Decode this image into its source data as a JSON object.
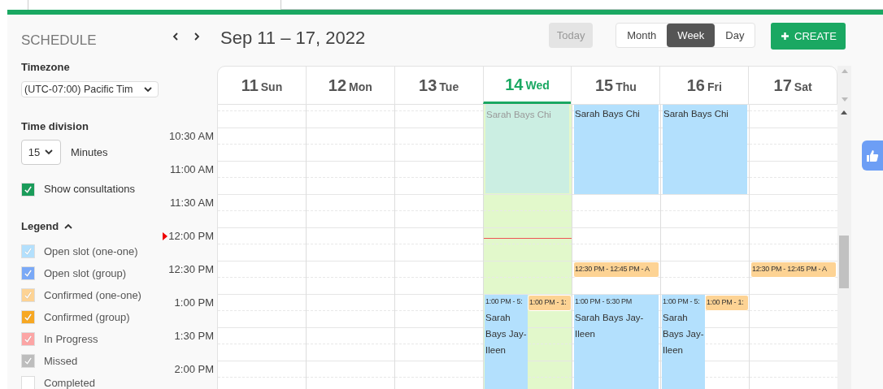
{
  "sidebar": {
    "title": "SCHEDULE",
    "timezone": {
      "label": "Timezone",
      "value": "(UTC-07:00) Pacific Tim"
    },
    "time_division": {
      "label": "Time division",
      "value": "15",
      "unit": "Minutes"
    },
    "show_consultations": {
      "label": "Show consultations",
      "checked": true
    },
    "legend": {
      "title": "Legend",
      "expanded": true,
      "items": [
        {
          "label": "Open slot (one-one)",
          "color": "#b3e0fd",
          "checked": true
        },
        {
          "label": "Open slot (group)",
          "color": "#7aa9f7",
          "checked": true
        },
        {
          "label": "Confirmed (one-one)",
          "color": "#fdd394",
          "checked": true
        },
        {
          "label": "Confirmed (group)",
          "color": "#f7a823",
          "checked": true
        },
        {
          "label": "In Progress",
          "color": "#fca5a5",
          "checked": true
        },
        {
          "label": "Missed",
          "color": "#bdbdbd",
          "checked": true
        },
        {
          "label": "Completed",
          "color": "#ffffff",
          "checked": false
        }
      ]
    }
  },
  "toolbar": {
    "range": "Sep 11 – 17, 2022",
    "today": {
      "label": "Today",
      "disabled": true
    },
    "views": [
      {
        "label": "Month",
        "selected": false
      },
      {
        "label": "Week",
        "selected": true
      },
      {
        "label": "Day",
        "selected": false
      }
    ],
    "create": "CREATE"
  },
  "times": [
    {
      "label": "10:30 AM",
      "now": false
    },
    {
      "label": "11:00 AM",
      "now": false
    },
    {
      "label": "11:30 AM",
      "now": false
    },
    {
      "label": "12:00 PM",
      "now": true
    },
    {
      "label": "12:30 PM",
      "now": false
    },
    {
      "label": "1:00 PM",
      "now": false
    },
    {
      "label": "1:30 PM",
      "now": false
    },
    {
      "label": "2:00 PM",
      "now": false
    }
  ],
  "days": [
    {
      "number": "11",
      "weekday": "Sun",
      "today": false
    },
    {
      "number": "12",
      "weekday": "Mon",
      "today": false
    },
    {
      "number": "13",
      "weekday": "Tue",
      "today": false
    },
    {
      "number": "14",
      "weekday": "Wed",
      "today": true,
      "events": [
        {
          "kind": "past-block",
          "title": "Sarah Bays Chi"
        },
        {
          "kind": "open-session-half",
          "time": "1:00 PM - 5:",
          "title": "Sarah Bays Jay-Ileen"
        },
        {
          "kind": "confirmed-half",
          "time": "1:00 PM - 1:"
        }
      ]
    },
    {
      "number": "15",
      "weekday": "Thu",
      "today": false,
      "events": [
        {
          "kind": "open-block",
          "title": "Sarah Bays Chi"
        },
        {
          "kind": "confirmed-bar",
          "time": "12:30 PM - 12:45 PM - A"
        },
        {
          "kind": "open-session",
          "time": "1:00 PM - 5:30 PM",
          "title": "Sarah Bays Jay-Ileen"
        }
      ]
    },
    {
      "number": "16",
      "weekday": "Fri",
      "today": false,
      "events": [
        {
          "kind": "open-block",
          "title": "Sarah Bays Chi"
        },
        {
          "kind": "open-session-half",
          "time": "1:00 PM - 5:",
          "title": "Sarah Bays Jay-Ileen"
        },
        {
          "kind": "confirmed-half",
          "time": "1:00 PM - 1:"
        }
      ]
    },
    {
      "number": "17",
      "weekday": "Sat",
      "today": false,
      "events": [
        {
          "kind": "confirmed-bar",
          "time": "12:30 PM - 12:45 PM - A"
        }
      ]
    }
  ]
}
